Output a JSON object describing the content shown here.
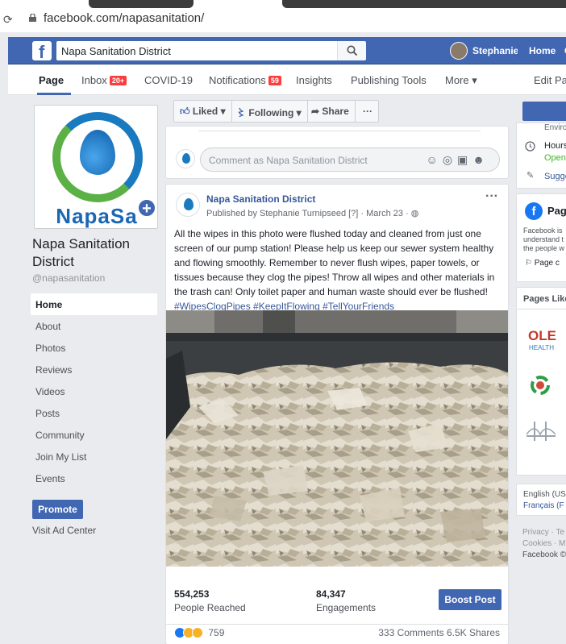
{
  "browser": {
    "url": "facebook.com/napasanitation/"
  },
  "topbar": {
    "search_value": "Napa Sanitation District",
    "user_name": "Stephanie",
    "home_label": "Home",
    "cutoff_label": "C"
  },
  "page_tabs": {
    "page": "Page",
    "inbox": "Inbox",
    "inbox_badge": "20+",
    "covid": "COVID-19",
    "notifications": "Notifications",
    "notifications_badge": "59",
    "insights": "Insights",
    "publishing": "Publishing Tools",
    "more": "More ▾",
    "edit": "Edit Pa"
  },
  "profile": {
    "logo_text": "NapaSa",
    "name": "Napa Sanitation District",
    "handle": "@napasanitation"
  },
  "left_nav": [
    "Home",
    "About",
    "Photos",
    "Reviews",
    "Videos",
    "Posts",
    "Community",
    "Join My List",
    "Events"
  ],
  "promote_label": "Promote",
  "ad_center_label": "Visit Ad Center",
  "actions": {
    "liked": "Liked ▾",
    "following": "Following ▾",
    "share": "Share",
    "more": "···"
  },
  "comment_placeholder": "Comment as Napa Sanitation District",
  "post": {
    "author": "Napa Sanitation District",
    "meta": "Published by Stephanie Turnipseed [?] · March 23 ·",
    "text": "All the wipes in this photo were flushed today and cleaned from just one screen of our pump station! Please help us keep our sewer system healthy and flowing smoothly. Remember to never flush wipes, paper towels, or tissues because they clog the pipes! Throw all wipes and other materials in the trash can! Only toilet paper and human waste should ever be flushed!",
    "hashtags": "#WipesClogPipes #KeepItFlowing #TellYourFriends",
    "reached_value": "554,253",
    "reached_label": "People Reached",
    "engagements_value": "84,347",
    "engagements_label": "Engagements",
    "boost_label": "Boost Post",
    "reaction_count": "759",
    "comments": "333 Comments",
    "shares": "6.5K Shares"
  },
  "right": {
    "enviro": "Enviro",
    "hours": "Hours",
    "open": "Open",
    "suggest": "Sugge",
    "fb_section": "Page",
    "fb_line1": "Facebook is",
    "fb_line2": "understand t",
    "fb_line3": "the people w",
    "page_c": "Page c",
    "pages_liked": "Pages Like",
    "ole": "OLE",
    "health": "HEALTH",
    "lang1": "English (US",
    "lang2": "Français (F",
    "foot1": "Privacy · Te",
    "foot2": "Cookies · M",
    "foot3": "Facebook ©"
  },
  "colors": {
    "fb_blue": "#4267b2",
    "badge_red": "#fa3e3e",
    "link": "#365899"
  }
}
